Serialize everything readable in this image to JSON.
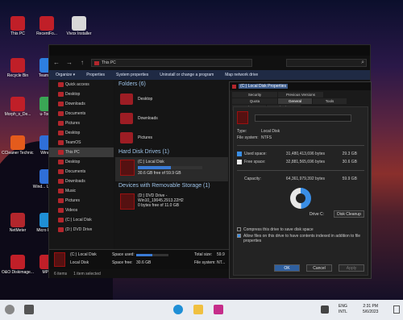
{
  "desktop_icons": [
    {
      "label": "This PC",
      "color": "#c01f28"
    },
    {
      "label": "RecentFo...",
      "color": "#c01f28"
    },
    {
      "label": "Vivox Installer",
      "color": "#d8d8d8"
    },
    {
      "label": "Recycle Bin",
      "color": "#c01f28"
    },
    {
      "label": "TeamO...",
      "color": "#2d7fe0"
    },
    {
      "label": "Morph_s_De...",
      "color": "#c01f28"
    },
    {
      "label": "u-Torr...",
      "color": "#3aa655"
    },
    {
      "label": "CCleaner Technic...",
      "color": "#e45b1c"
    },
    {
      "label": "Wind...",
      "color": "#2f6fd8"
    },
    {
      "label": "Wind... Updat...",
      "color": "#2f6fd8"
    },
    {
      "label": "NetMeter",
      "color": "#b3262c"
    },
    {
      "label": "Micro Edge",
      "color": "#1f8fd6"
    },
    {
      "label": "O&O Diskimage...",
      "color": "#c01f28"
    },
    {
      "label": "MPC",
      "color": "#c01f28"
    }
  ],
  "explorer": {
    "address": "This PC",
    "cmdbar": [
      "Organize ▾",
      "Properties",
      "System properties",
      "Uninstall or change a program",
      "Map network drive"
    ],
    "nav": [
      {
        "label": "Quick access",
        "sel": false
      },
      {
        "label": "Desktop",
        "sel": false
      },
      {
        "label": "Downloads",
        "sel": false
      },
      {
        "label": "Documents",
        "sel": false
      },
      {
        "label": "Pictures",
        "sel": false
      },
      {
        "label": "Desktop",
        "sel": false
      },
      {
        "label": "TeamOS",
        "sel": false
      },
      {
        "label": "This PC",
        "sel": true
      },
      {
        "label": "Desktop",
        "sel": false
      },
      {
        "label": "Documents",
        "sel": false
      },
      {
        "label": "Downloads",
        "sel": false
      },
      {
        "label": "Music",
        "sel": false
      },
      {
        "label": "Pictures",
        "sel": false
      },
      {
        "label": "Videos",
        "sel": false
      },
      {
        "label": "(C:) Local Disk",
        "sel": false
      },
      {
        "label": "(D:) DVD Drive",
        "sel": false
      }
    ],
    "folders_header": "Folders (6)",
    "folders": [
      "Desktop",
      "Downloads",
      "Pictures"
    ],
    "hdd_header": "Hard Disk Drives (1)",
    "drive_c": {
      "name": "(C:) Local Disk",
      "free": "30.6 GB free of 59.9 GB",
      "used_fraction": 0.51
    },
    "removable_header": "Devices with Removable Storage (1)",
    "dvd": {
      "name": "(D:) DVD Drive - Win10_19045.2913.22H2",
      "free": "0 bytes free of 11.0 GB"
    },
    "detail": {
      "name": "(C:) Local Disk",
      "type": "Local Disk",
      "used_label": "Space used:",
      "free_label": "Space free:",
      "free_value": "30.6 GB",
      "total_label": "Total size:",
      "total_value": "59.9",
      "fs_label": "File system:",
      "fs_value": "NT..."
    },
    "status": {
      "items": "6 items",
      "selected": "1 item selected"
    }
  },
  "props": {
    "title": "(C:) Local Disk Properties",
    "tabs": [
      "Security",
      "Previous Versions",
      "Quota",
      "General",
      "Tools",
      "Hardware",
      "Sharing"
    ],
    "active_tab": "General",
    "type_label": "Type:",
    "type_value": "Local Disk",
    "fs_label": "File system:",
    "fs_value": "NTFS",
    "used_label": "Used space:",
    "used_bytes": "31,480,413,696 bytes",
    "used_gb": "29.3 GB",
    "used_color": "#3a8ee6",
    "free_label": "Free space:",
    "free_bytes": "32,881,565,696 bytes",
    "free_gb": "30.6 GB",
    "free_color": "#e8e8e8",
    "cap_label": "Capacity:",
    "cap_bytes": "64,361,979,392 bytes",
    "cap_gb": "59.9 GB",
    "drive_label": "Drive C:",
    "cleanup": "Disk Cleanup",
    "compress": "Compress this drive to save disk space",
    "index": "Allow files on this drive to have contents indexed in addition to file properties",
    "ok": "OK",
    "cancel": "Cancel",
    "apply": "Apply"
  },
  "taskbar": {
    "lang": "ENG",
    "layout": "INTL",
    "time": "2:31 PM",
    "date": "5/6/2023"
  }
}
